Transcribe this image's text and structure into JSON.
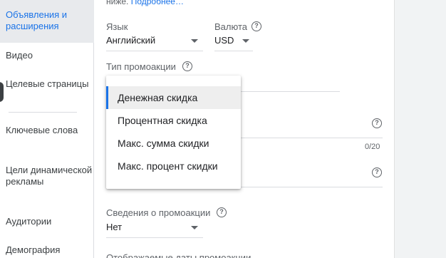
{
  "sidebar": {
    "items": [
      {
        "label": "Объявления и расширения",
        "active": true
      },
      {
        "label": "Видео"
      },
      {
        "label": "Целевые страницы"
      },
      {
        "label": "Ключевые слова"
      },
      {
        "label": "Цели динамической рекламы"
      },
      {
        "label": "Аудитории"
      },
      {
        "label": "Демография"
      }
    ]
  },
  "form": {
    "top_text": "ниже.",
    "top_link": "Подробнее…",
    "language": {
      "label": "Язык",
      "value": "Английский"
    },
    "currency": {
      "label": "Валюта",
      "value": "USD"
    },
    "promo_type": {
      "label": "Тип промоакции"
    },
    "counter": "0/20",
    "promo_details": {
      "label": "Сведения о промоакции",
      "value": "Нет"
    },
    "promo_dates_label": "Отображаемые даты промоакции"
  },
  "menu": {
    "options": [
      "Денежная скидка",
      "Процентная скидка",
      "Макс. сумма скидки",
      "Макс. процент скидки"
    ],
    "selected_index": 0
  },
  "colors": {
    "accent": "#1a73e8",
    "selected_bg": "#eeeeee",
    "active_nav_bg": "#e8eaed"
  }
}
